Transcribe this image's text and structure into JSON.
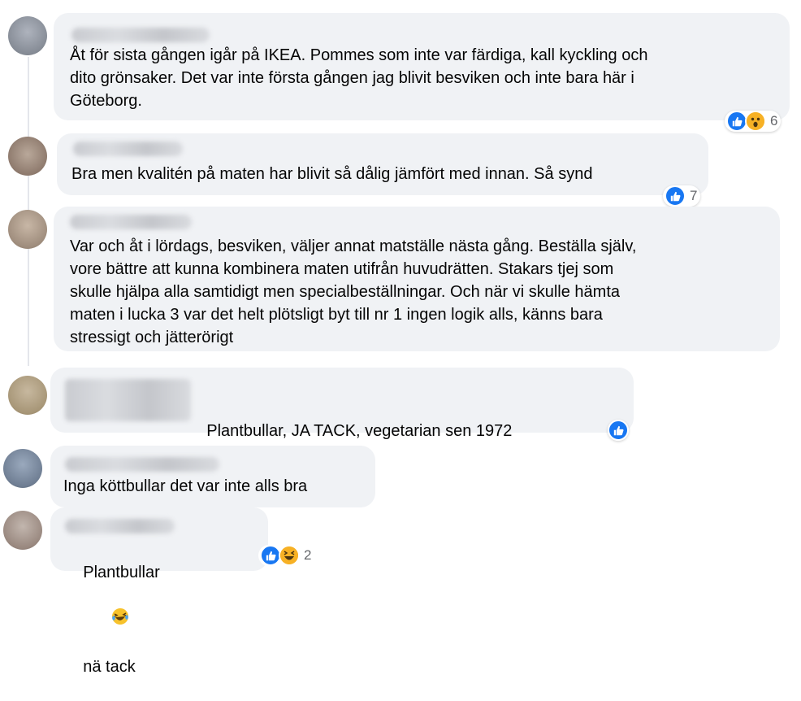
{
  "comments": [
    {
      "text": "Åt för sista gången igår på IKEA. Pommes som inte var färdiga, kall kyckling och\ndito grönsaker. Det var inte första gången jag blivit besviken och inte bara här i\nGöteborg.",
      "reaction_count": "6"
    },
    {
      "text": "Bra men kvalitén på maten har blivit så dålig jämfört med innan. Så synd",
      "reaction_count": "7"
    },
    {
      "text": "Var och åt i lördags, besviken, väljer annat matställe nästa gång. Beställa själv,\nvore bättre att kunna kombinera maten utifrån huvudrätten. Stakars tjej som\nskulle hjälpa alla samtidigt men specialbeställningar. Och när vi skulle hämta\nmaten i lucka 3 var det helt plötsligt byt till nr 1 ingen logik alls, känns bara\nstressigt och jätterörigt"
    },
    {
      "text": "Plantbullar, JA TACK, vegetarian sen 1972"
    },
    {
      "text": "Inga köttbullar det var inte alls bra"
    },
    {
      "text": "Plantbullar",
      "text_after": "nä tack",
      "reaction_count": "2"
    }
  ],
  "colors": {
    "bubble": "#f0f2f5",
    "like": "#1877f2",
    "reaction_yellow": "#f7b125",
    "count": "#65676b"
  },
  "icons": [
    "like-icon",
    "wow-icon",
    "haha-icon",
    "smile-emoji",
    "pray-emoji",
    "hearts-emoji",
    "laughing-emoji"
  ]
}
